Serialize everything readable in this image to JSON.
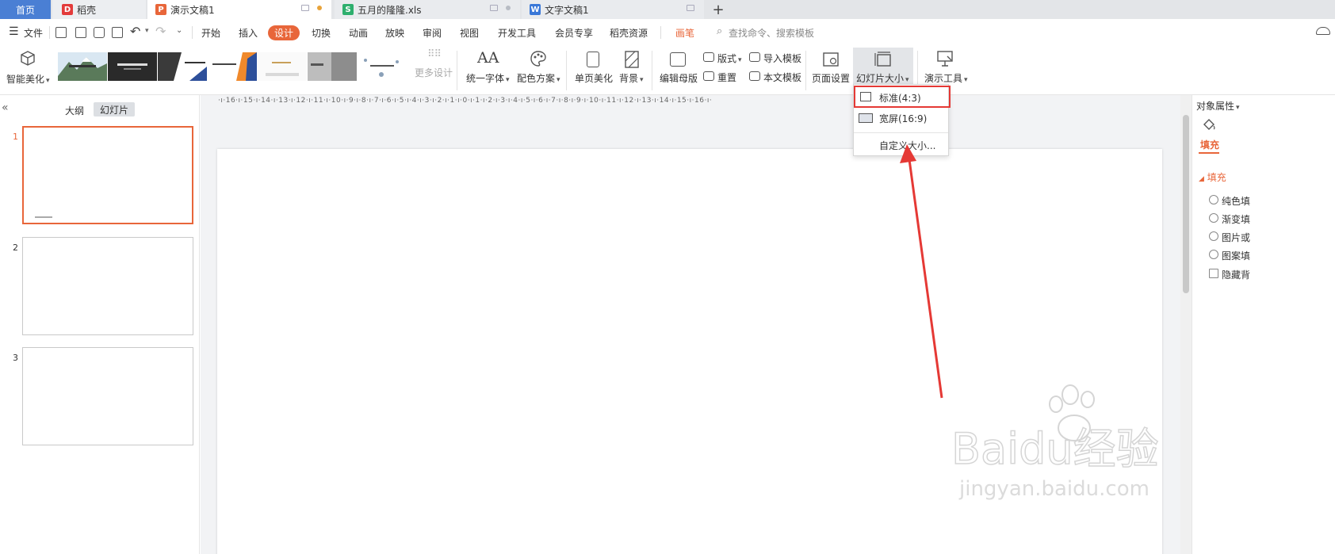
{
  "tabs": {
    "home": "首页",
    "shell": "稻壳",
    "ppt": "演示文稿1",
    "xls": "五月的隆隆.xls",
    "doc": "文字文稿1"
  },
  "menu": {
    "file": "文件",
    "items": [
      "开始",
      "插入",
      "设计",
      "切换",
      "动画",
      "放映",
      "审阅",
      "视图",
      "开发工具",
      "会员专享",
      "稻壳资源",
      "画笔"
    ],
    "active": "设计",
    "search_placeholder": "查找命令、搜索模板"
  },
  "ribbon": {
    "smart_beautify": "智能美化",
    "more_design": "更多设计",
    "unify_font": "统一字体",
    "color_scheme": "配色方案",
    "single_beautify": "单页美化",
    "background": "背景",
    "edit_master": "编辑母版",
    "layout": "版式",
    "reset": "重置",
    "import_template": "导入模板",
    "this_template": "本文模板",
    "page_setup": "页面设置",
    "slide_size": "幻灯片大小",
    "presentation_tools": "演示工具"
  },
  "left_panel": {
    "outline_tab": "大纲",
    "slides_tab": "幻灯片",
    "slide_numbers": [
      "1",
      "2",
      "3"
    ]
  },
  "ruler": "·ı·16·ı·15·ı·14·ı·13·ı·12·ı·11·ı·10·ı·9·ı·8·ı·7·ı·6·ı·5·ı·4·ı·3·ı·2·ı·1·ı·0·ı·1·ı·2·ı·3·ı·4·ı·5·ı·6·ı·7·ı·8·ı·9·ı·10·ı·11·ı·12·ı·13·ı·14·ı·15·ı·16·ı·",
  "dropdown": {
    "standard": "标准(4:3)",
    "widescreen": "宽屏(16:9)",
    "custom": "自定义大小..."
  },
  "right_panel": {
    "title": "对象属性",
    "fill_tab": "填充",
    "fill_section": "填充",
    "options": [
      "纯色填",
      "渐变填",
      "图片或",
      "图案填"
    ],
    "hide_option": "隐藏背"
  },
  "watermark": {
    "brand": "Baidu经验",
    "url": "jingyan.baidu.com"
  },
  "colors": {
    "accent": "#e8663a",
    "highlight": "#e53935",
    "home_tab": "#4a7fd4"
  }
}
